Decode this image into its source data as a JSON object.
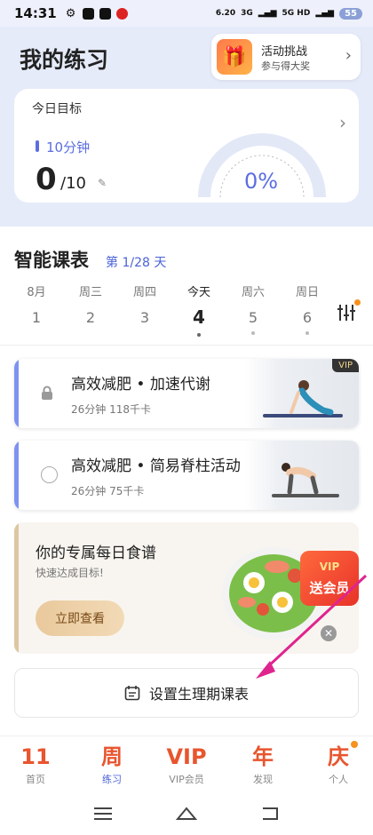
{
  "status": {
    "time": "14:31",
    "speed": "6.20",
    "network": "3G",
    "network2": "5G HD",
    "battery": "55"
  },
  "header": {
    "title": "我的练习",
    "challenge_title": "活动挑战",
    "challenge_sub": "参与得大奖"
  },
  "goal": {
    "title": "今日目标",
    "minutes": "10分钟",
    "current": "0",
    "total": "/10",
    "percent": "0%",
    "progress": 0
  },
  "schedule": {
    "title": "智能课表",
    "week": "第 1/28 天",
    "days": [
      {
        "name": "8月",
        "date": "1"
      },
      {
        "name": "周三",
        "date": "2"
      },
      {
        "name": "周四",
        "date": "3"
      },
      {
        "name": "今天",
        "date": "4"
      },
      {
        "name": "周六",
        "date": "5"
      },
      {
        "name": "周日",
        "date": "6"
      }
    ]
  },
  "lessons": [
    {
      "title": "高效减肥 • 加速代谢",
      "meta": "26分钟  118千卡",
      "badge": "VIP"
    },
    {
      "title": "高效减肥 • 简易脊柱活动",
      "meta": "26分钟  75千卡"
    }
  ],
  "recipe": {
    "title": "你的专属每日食谱",
    "sub": "快速达成目标!",
    "button": "立即查看",
    "vip_label": "VIP",
    "vip_text": "送会员"
  },
  "period": {
    "label": "设置生理期课表"
  },
  "tabs": [
    {
      "icon": "11",
      "label": "首页"
    },
    {
      "icon": "周",
      "label": "练习"
    },
    {
      "icon": "VIP",
      "label": "VIP会员"
    },
    {
      "icon": "年",
      "label": "发现"
    },
    {
      "icon": "庆",
      "label": "个人"
    }
  ],
  "colors": {
    "accent": "#4a63d8",
    "header_bg": "#e6ebfa",
    "tab_icon": "#e8552e",
    "arrow": "#e0248e"
  }
}
